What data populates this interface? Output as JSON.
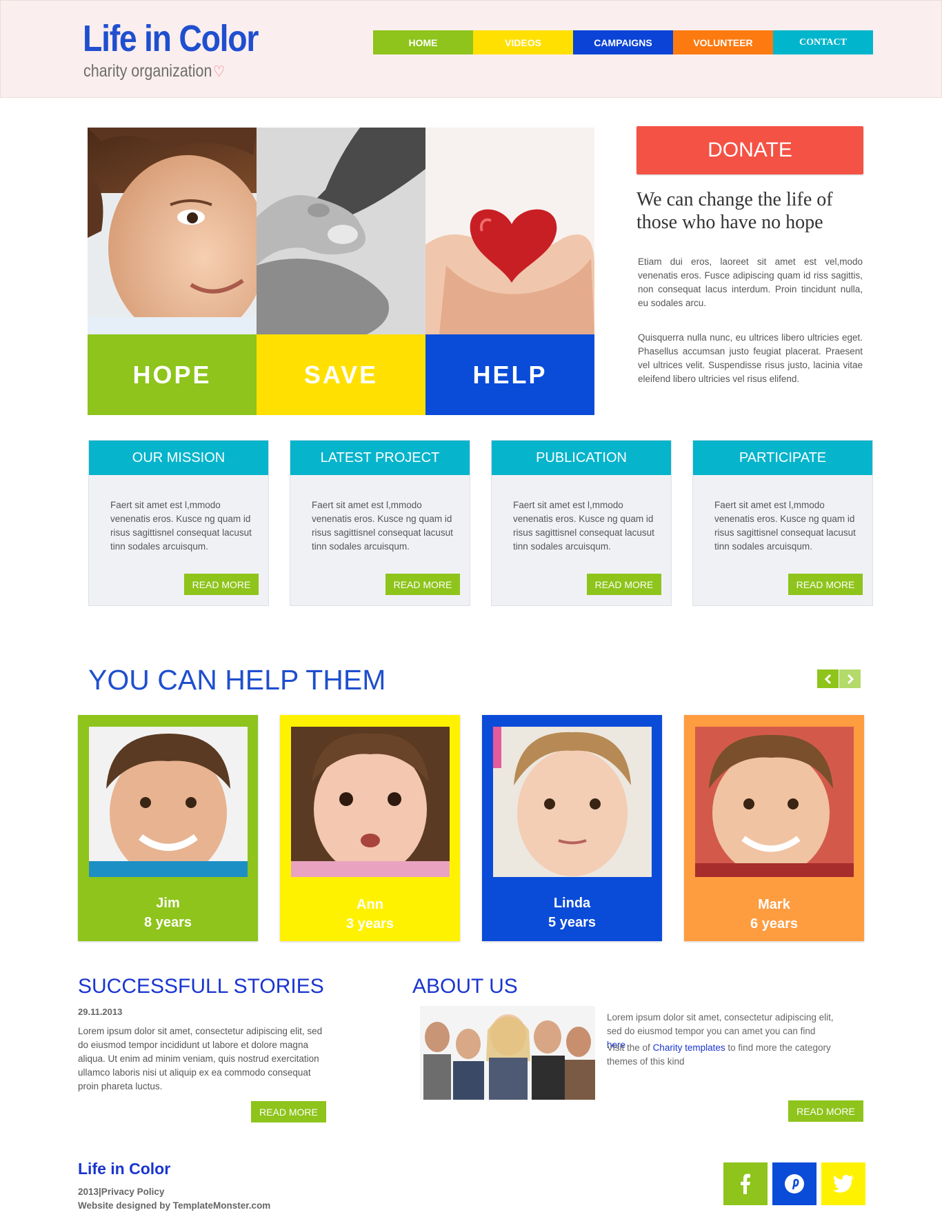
{
  "header": {
    "logo_title": "Life in Color",
    "logo_subtitle": "charity organization",
    "nav": [
      {
        "label": "HOME",
        "color": "#8ec41b"
      },
      {
        "label": "VIDEOS",
        "color": "#ffe000"
      },
      {
        "label": "CAMPAIGNS",
        "color": "#0a43d6"
      },
      {
        "label": "VOLUNTEER",
        "color": "#fc7a10"
      },
      {
        "label": "CONTACT",
        "color": "#00b5cc"
      }
    ]
  },
  "hero": {
    "bands": [
      {
        "label": "HOPE",
        "color": "#8ec41b"
      },
      {
        "label": "SAVE",
        "color": "#ffe000"
      },
      {
        "label": "HELP",
        "color": "#0a4bd8"
      }
    ]
  },
  "donate": {
    "button_label": "DONATE",
    "heading": "We can change the life of those who have no hope",
    "paragraph_1": "Etiam dui eros, laoreet sit amet est vel,modo venenatis eros. Fusce adipiscing quam id riss sagittis, non consequat lacus interdum. Proin tincidunt nulla, eu sodales arcu.",
    "paragraph_2": "Quisquerra nulla nunc, eu ultrices libero ultricies eget. Phasellus accumsan justo feugiat placerat. Praesent vel ultrices velit. Suspendisse risus justo, lacinia vitae eleifend libero ultricies vel risus elifend."
  },
  "info_boxes": [
    {
      "title": "OUR MISSION",
      "text": "Faert sit amet est l,mmodo venenatis eros. Kusce ng quam id risus sagittisnel consequat lacusut tinn sodales arcuisqum.",
      "button": "READ MORE"
    },
    {
      "title": "LATEST PROJECT",
      "text": "Faert sit amet est l,mmodo venenatis eros. Kusce ng quam id risus sagittisnel consequat lacusut tinn sodales arcuisqum.",
      "button": "READ MORE"
    },
    {
      "title": "PUBLICATION",
      "text": "Faert sit amet est l,mmodo venenatis eros. Kusce ng quam id risus sagittisnel consequat lacusut tinn sodales arcuisqum.",
      "button": "READ MORE"
    },
    {
      "title": "PARTICIPATE",
      "text": "Faert sit amet est l,mmodo venenatis eros. Kusce ng quam id risus sagittisnel consequat lacusut tinn sodales arcuisqum.",
      "button": "READ MORE"
    }
  ],
  "help": {
    "title": "YOU CAN HELP THEM",
    "prev_icon": "chevron-left-icon",
    "next_icon": "chevron-right-icon",
    "children": [
      {
        "name": "Jim",
        "age": "8 years",
        "color": "#8ec41b"
      },
      {
        "name": "Ann",
        "age": "3 years",
        "color": "#fff200"
      },
      {
        "name": "Linda",
        "age": "5 years",
        "color": "#0a4bd8"
      },
      {
        "name": "Mark",
        "age": "6 years",
        "color": "#fe9c40"
      }
    ]
  },
  "stories": {
    "title": "SUCCESSFULL STORIES",
    "date": "29.11.2013",
    "text": "Lorem ipsum dolor sit amet, consectetur adipiscing elit, sed do eiusmod tempor incididunt ut labore et dolore magna aliqua. Ut enim ad minim veniam, quis nostrud exercitation ullamco laboris nisi ut aliquip ex ea commodo consequat proin phareta luctus.",
    "button": "READ MORE"
  },
  "about": {
    "title": "ABOUT US",
    "text_1": "Lorem ipsum dolor sit amet, consectetur adipiscing elit, sed do eiusmod tempor you can amet you can find",
    "link_1": "here",
    "text_2a": "Visit the of",
    "link_2": "Charity templates",
    "text_2b": "to find more the category themes of this kind",
    "button": "READ MORE"
  },
  "footer": {
    "title": "Life in Color",
    "line_1": "2013|Privacy Policy",
    "line_2": "Website designed by TemplateMonster.com",
    "social": [
      {
        "icon": "facebook-icon",
        "glyph": "f",
        "color": "#8ec41b"
      },
      {
        "icon": "pinterest-icon",
        "glyph": "P",
        "color": "#0a4bd8"
      },
      {
        "icon": "twitter-icon",
        "glyph": "t",
        "color": "#fff200"
      }
    ]
  }
}
